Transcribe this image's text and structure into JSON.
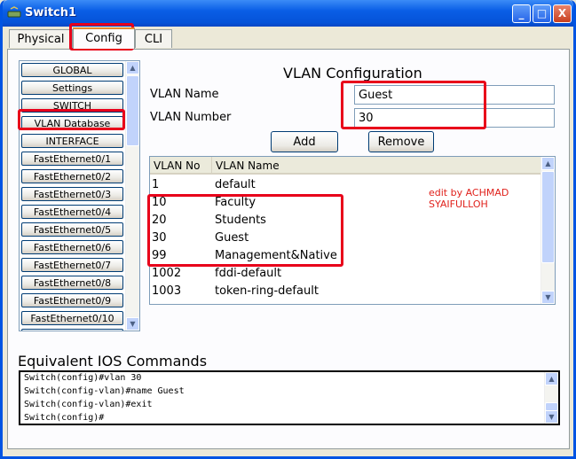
{
  "window": {
    "title": "Switch1",
    "min": "_",
    "max": "□",
    "close": "X"
  },
  "tabs": [
    {
      "label": "Physical"
    },
    {
      "label": "Config"
    },
    {
      "label": "CLI"
    }
  ],
  "nav": {
    "items": [
      {
        "label": "GLOBAL"
      },
      {
        "label": "Settings"
      },
      {
        "label": "SWITCH"
      },
      {
        "label": "VLAN Database"
      },
      {
        "label": "INTERFACE"
      },
      {
        "label": "FastEthernet0/1"
      },
      {
        "label": "FastEthernet0/2"
      },
      {
        "label": "FastEthernet0/3"
      },
      {
        "label": "FastEthernet0/4"
      },
      {
        "label": "FastEthernet0/5"
      },
      {
        "label": "FastEthernet0/6"
      },
      {
        "label": "FastEthernet0/7"
      },
      {
        "label": "FastEthernet0/8"
      },
      {
        "label": "FastEthernet0/9"
      },
      {
        "label": "FastEthernet0/10"
      }
    ]
  },
  "vlan_config": {
    "title": "VLAN Configuration",
    "name_label": "VLAN Name",
    "name_value": "Guest",
    "number_label": "VLAN Number",
    "number_value": "30",
    "add_label": "Add",
    "remove_label": "Remove"
  },
  "vlan_table": {
    "headers": [
      "VLAN No",
      "VLAN Name"
    ],
    "rows": [
      {
        "no": "1",
        "name": "default"
      },
      {
        "no": "10",
        "name": "Faculty"
      },
      {
        "no": "20",
        "name": "Students"
      },
      {
        "no": "30",
        "name": "Guest"
      },
      {
        "no": "99",
        "name": "Management&Native"
      },
      {
        "no": "1002",
        "name": "fddi-default"
      },
      {
        "no": "1003",
        "name": "token-ring-default"
      }
    ]
  },
  "annotation": {
    "text": "edit by ACHMAD SYAIFULLOH",
    "color": "#e0221c"
  },
  "ios": {
    "title": "Equivalent IOS Commands",
    "lines": [
      "Switch(config)#vlan 30",
      "Switch(config-vlan)#name Guest",
      "Switch(config-vlan)#exit",
      "Switch(config)#"
    ]
  },
  "colors": {
    "titlebar": "#0a5ee6",
    "highlight_box": "#e8001a",
    "tab_accent": "#e68b2c"
  }
}
